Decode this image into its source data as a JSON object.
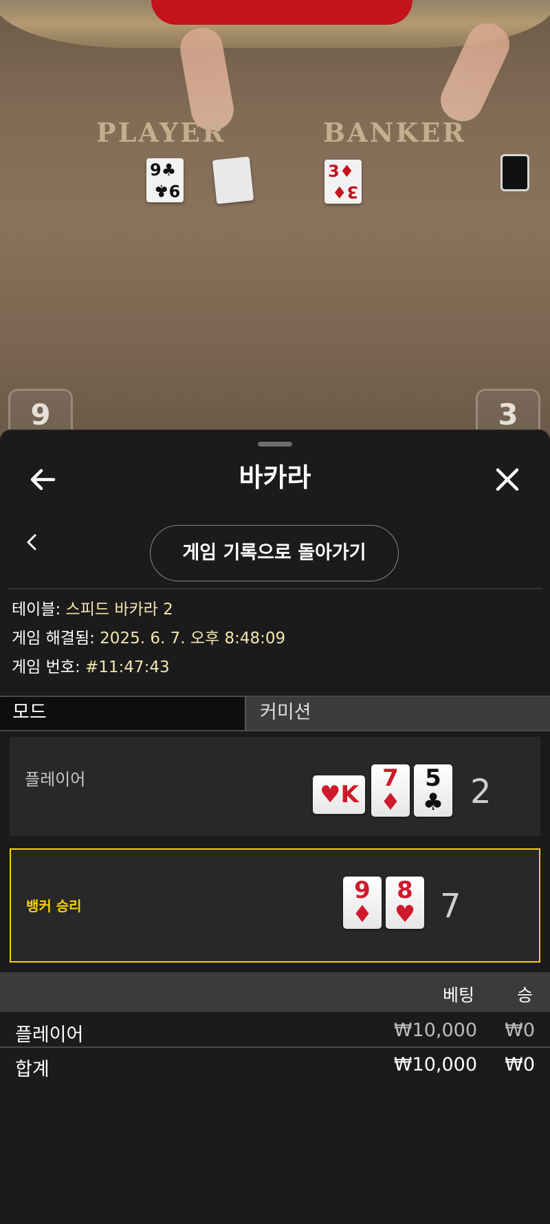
{
  "video": {
    "player_label": "PLAYER",
    "banker_label": "BANKER",
    "player_table_card": {
      "rank": "9",
      "suit": "♣"
    },
    "banker_table_card": {
      "rank": "3",
      "suit": "♦"
    },
    "player_score_tab": "9",
    "banker_score_tab": "3"
  },
  "header": {
    "title": "바카라",
    "back_icon": "arrow-left-icon",
    "close_icon": "close-icon"
  },
  "nav": {
    "back_to_history": "게임 기록으로 돌아가기",
    "chevron_icon": "chevron-left-icon"
  },
  "info": {
    "table_label": "테이블: ",
    "table_value": "스피드 바카라 2",
    "resolved_label": "게임 해결됨: ",
    "resolved_value": "2025. 6. 7. 오후 8:48:09",
    "game_no_label": "게임 번호: ",
    "game_no_value": "#11:47:43"
  },
  "mode": {
    "label": "모드",
    "value": "커미션"
  },
  "hands": {
    "player": {
      "label": "플레이어",
      "score": "2",
      "cards": [
        {
          "rank": "K",
          "suit": "♥",
          "color": "#d0192c",
          "sideways": true
        },
        {
          "rank": "7",
          "suit": "♦",
          "color": "#d0192c",
          "sideways": false
        },
        {
          "rank": "5",
          "suit": "♣",
          "color": "#111111",
          "sideways": false
        }
      ]
    },
    "banker": {
      "label": "뱅커 승리",
      "score": "7",
      "cards": [
        {
          "rank": "9",
          "suit": "♦",
          "color": "#d0192c",
          "sideways": false
        },
        {
          "rank": "8",
          "suit": "♥",
          "color": "#d0192c",
          "sideways": false
        }
      ]
    }
  },
  "bets": {
    "header_bet": "베팅",
    "header_win": "승",
    "rows": [
      {
        "name": "플레이어",
        "bet": "₩10,000",
        "win": "₩0"
      }
    ],
    "total": {
      "name": "합계",
      "bet": "₩10,000",
      "win": "₩0"
    }
  },
  "colors": {
    "banker_win": "#f5d300",
    "info_value": "#f3e7b1",
    "sheet_bg": "#1b1b1b"
  }
}
